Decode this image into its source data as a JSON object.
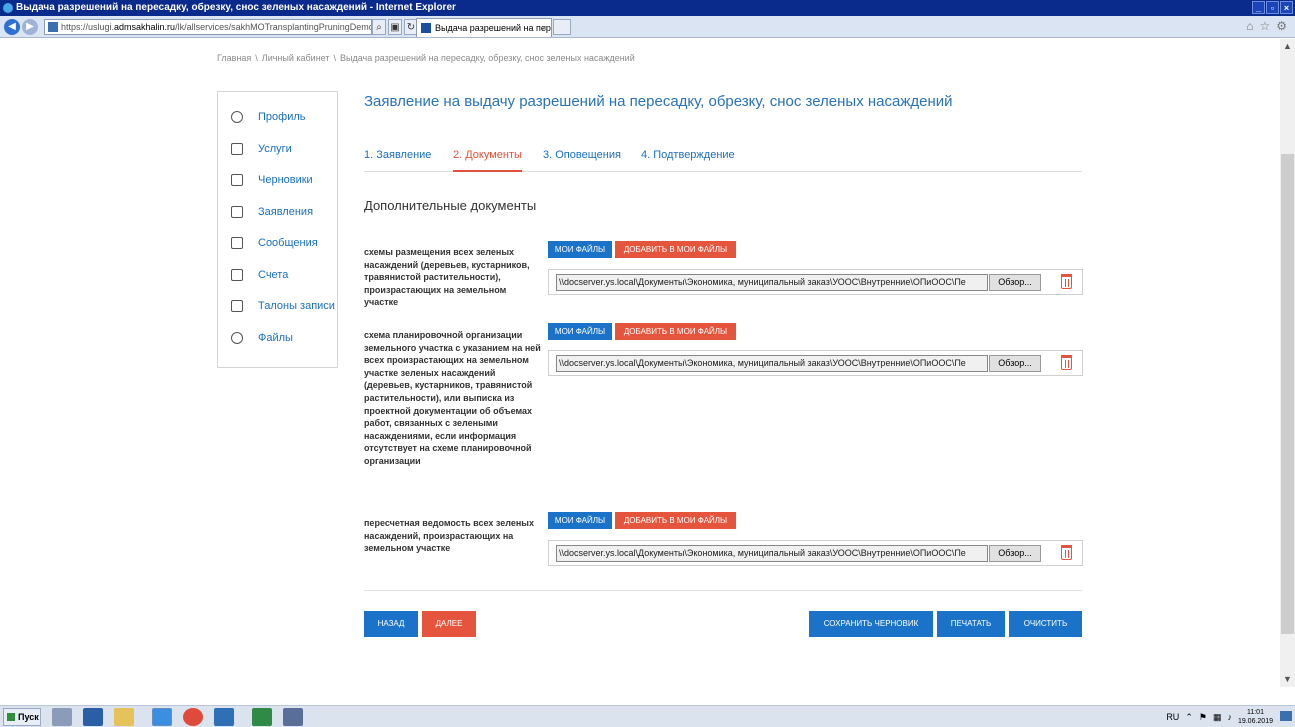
{
  "window": {
    "title": "Выдача разрешений на пересадку, обрезку, снос зеленых насаждений - Internet Explorer"
  },
  "browser": {
    "url_prefix": "https://uslugi.",
    "url_host": "admsakhalin.ru",
    "url_rest": "/lk/allservices/sakhMOTransplantingPruningDemolitionGreen",
    "tab_title": "Выдача разрешений на пер...",
    "tab_close": "×"
  },
  "breadcrumb": [
    "Главная",
    "Личный кабинет",
    "Выдача разрешений на пересадку, обрезку, снос зеленых насаждений"
  ],
  "breadcrumb_sep": "\\",
  "sidebar": {
    "items": [
      {
        "label": "Профиль",
        "icon": "profile-icon"
      },
      {
        "label": "Услуги",
        "icon": "list-icon"
      },
      {
        "label": "Черновики",
        "icon": "draft-icon"
      },
      {
        "label": "Заявления",
        "icon": "document-icon"
      },
      {
        "label": "Сообщения",
        "icon": "envelope-icon"
      },
      {
        "label": "Счета",
        "icon": "bill-icon"
      },
      {
        "label": "Талоны записи",
        "icon": "ticket-icon"
      },
      {
        "label": "Файлы",
        "icon": "files-icon"
      }
    ]
  },
  "main": {
    "title": "Заявление на выдачу разрешений на пересадку, обрезку, снос зеленых насаждений",
    "steps": [
      {
        "label": "1. Заявление",
        "active": false
      },
      {
        "label": "2. Документы",
        "active": true
      },
      {
        "label": "3. Оповещения",
        "active": false
      },
      {
        "label": "4. Подтверждение",
        "active": false
      }
    ],
    "section_title": "Дополнительные документы",
    "documents": [
      {
        "label": "схемы размещения всех зеленых насаждений (деревьев, кустарников, травянистой растительности), произрастающих на земельном участке",
        "file_path": "\\\\docserver.ys.local\\Документы\\Экономика, муниципальный заказ\\УООС\\Внутренние\\ОПиООС\\Пе"
      },
      {
        "label": "схема планировочной организации земельного участка с указанием на ней всех произрастающих на земельном участке зеленых насаждений (деревьев, кустарников, травянистой растительности), или выписка из проектной документации об объемах работ, связанных с зелеными насаждениями, если информация отсутствует на схеме планировочной организации",
        "file_path": "\\\\docserver.ys.local\\Документы\\Экономика, муниципальный заказ\\УООС\\Внутренние\\ОПиООС\\Пе"
      },
      {
        "label": "пересчетная ведомость всех зеленых насаждений, произрастающих на земельном участке",
        "file_path": "\\\\docserver.ys.local\\Документы\\Экономика, муниципальный заказ\\УООС\\Внутренние\\ОПиООС\\Пе"
      }
    ],
    "my_files_label": "МОИ ФАЙЛЫ",
    "add_to_my_files_label": "ДОБАВИТЬ В МОИ ФАЙЛЫ",
    "browse_label": "Обзор...",
    "actions": {
      "back": "НАЗАД",
      "next": "ДАЛЕЕ",
      "save_draft": "СОХРАНИТЬ ЧЕРНОВИК",
      "print": "ПЕЧАТАТЬ",
      "clear": "ОЧИСТИТЬ"
    }
  },
  "taskbar": {
    "start": "Пуск",
    "lang": "RU",
    "time": "11:01",
    "date": "19.06.2019"
  },
  "colors": {
    "accent_blue": "#1a73c8",
    "accent_red": "#e5553d",
    "link_blue": "#1a6fbf",
    "title_blue": "#2a73b8"
  }
}
